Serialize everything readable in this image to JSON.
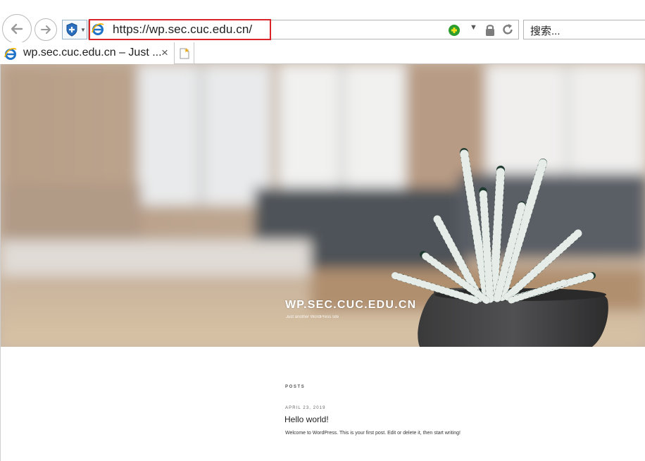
{
  "browser": {
    "address": {
      "url": "https://wp.sec.cuc.edu.cn/"
    },
    "search": {
      "placeholder": "搜索..."
    },
    "tab": {
      "title": "wp.sec.cuc.edu.cn – Just ...",
      "close": "×"
    }
  },
  "site": {
    "title": "WP.SEC.CUC.EDU.CN",
    "description": "Just another WordPress site"
  },
  "content": {
    "section_label": "POSTS",
    "post": {
      "date": "APRIL 23, 2019",
      "title": "Hello world!",
      "excerpt": "Welcome to WordPress. This is your first post. Edit or delete it, then start writing!"
    }
  },
  "colors": {
    "highlight": "#d9252a",
    "accent": "#1f73c9"
  },
  "icons": [
    "back-arrow-icon",
    "forward-arrow-icon",
    "shield-plus-icon",
    "ie-logo-icon",
    "compat-view-icon",
    "lock-icon",
    "refresh-icon",
    "new-tab-icon"
  ]
}
